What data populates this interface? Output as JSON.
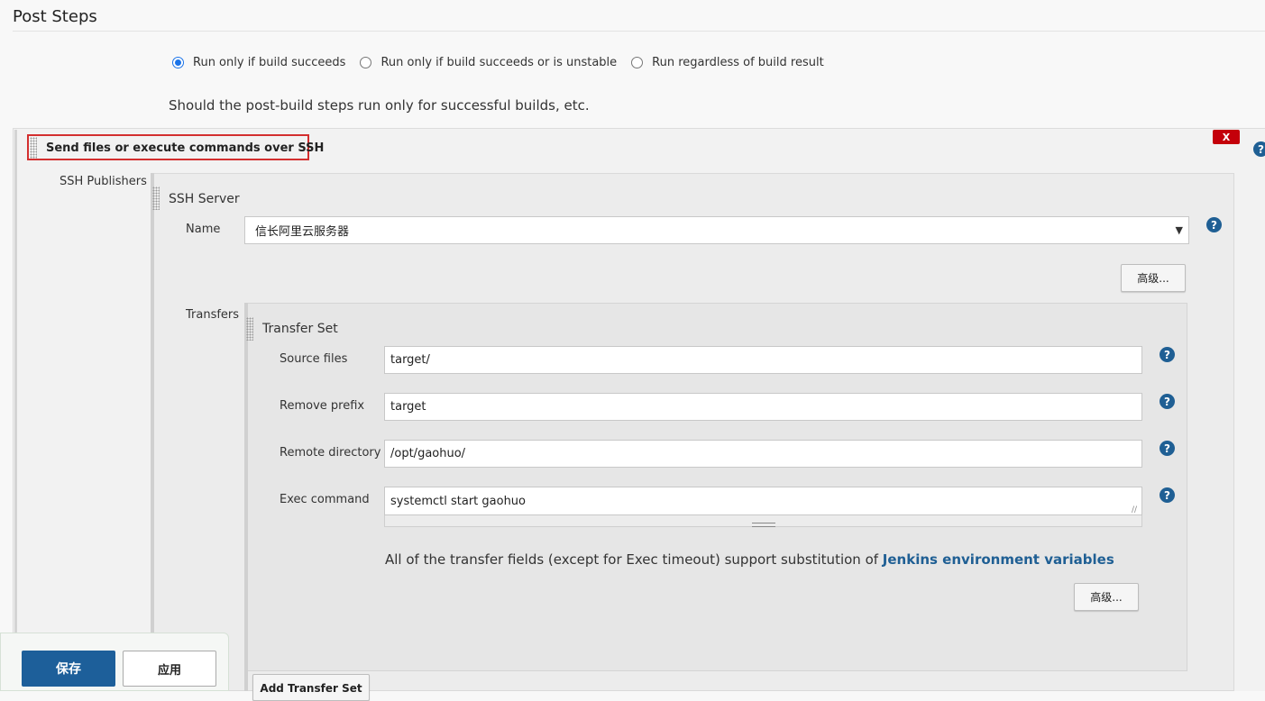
{
  "header": {
    "title": "Post Steps"
  },
  "run_condition": {
    "options": [
      {
        "label": "Run only if build succeeds",
        "checked": true
      },
      {
        "label": "Run only if build succeeds or is unstable",
        "checked": false
      },
      {
        "label": "Run regardless of build result",
        "checked": false
      }
    ],
    "description": "Should the post-build steps run only for successful builds, etc."
  },
  "step": {
    "title": "Send files or execute commands over SSH",
    "delete_label": "X",
    "publishers_label": "SSH Publishers",
    "ssh_server_label": "SSH Server",
    "name_label": "Name",
    "name_value": "信长阿里云服务器",
    "advanced_label": "高级...",
    "transfers_label": "Transfers",
    "transfer_set": {
      "title": "Transfer Set",
      "source_files_label": "Source files",
      "source_files_value": "target/",
      "remove_prefix_label": "Remove prefix",
      "remove_prefix_value": "target",
      "remote_directory_label": "Remote directory",
      "remote_directory_value": "/opt/gaohuo/",
      "exec_command_label": "Exec command",
      "exec_command_value": "systemctl start gaohuo",
      "note_prefix": "All of the transfer fields (except for Exec timeout) support substitution of ",
      "note_link": "Jenkins environment variables",
      "advanced_label": "高级..."
    },
    "add_transfer_label": "Add Transfer Set"
  },
  "footer": {
    "save_label": "保存",
    "apply_label": "应用"
  },
  "icons": {
    "help": "?"
  },
  "colors": {
    "accent": "#1d5f9a",
    "danger": "#c4000a",
    "highlight_border": "#d32f2f"
  }
}
